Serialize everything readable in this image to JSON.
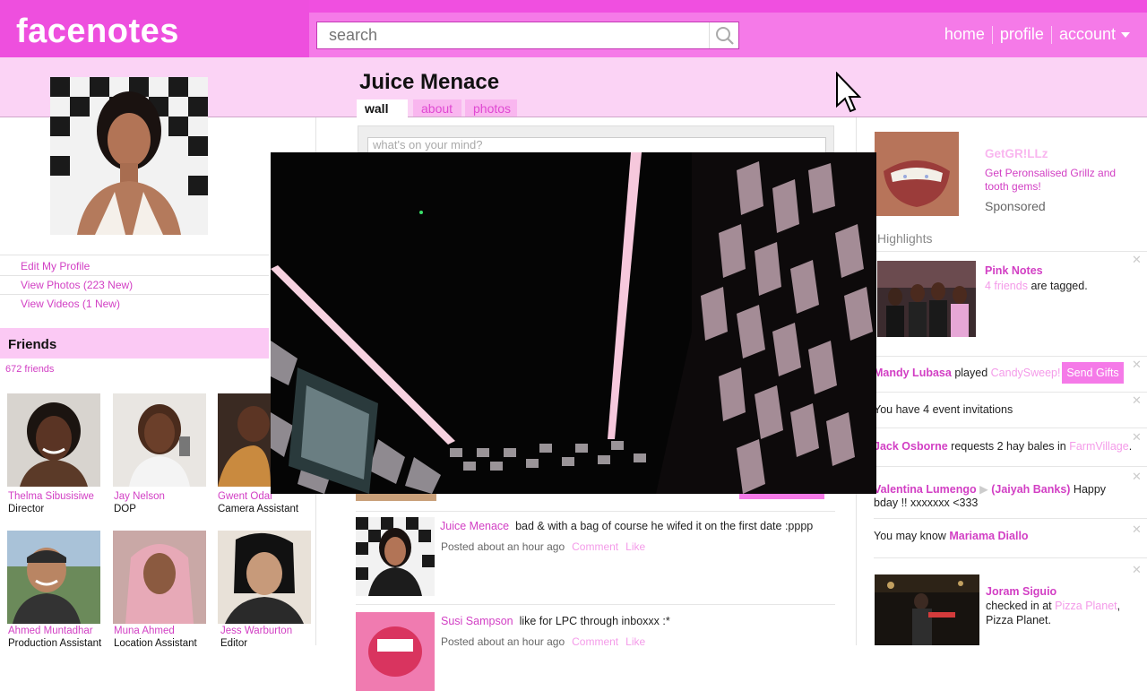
{
  "app": {
    "logo": "facenotes"
  },
  "search": {
    "placeholder": "search"
  },
  "nav": {
    "home": "home",
    "profile": "profile",
    "account": "account"
  },
  "profile": {
    "name": "Juice Menace",
    "tabs": {
      "wall": "wall",
      "about": "about",
      "photos": "photos"
    },
    "status_placeholder": "what's on your mind?"
  },
  "left": {
    "links": {
      "edit": "Edit My Profile",
      "photos": "View Photos (223 New)",
      "videos": "View Videos (1 New)"
    },
    "friends": {
      "title": "Friends",
      "count": "672 friends",
      "items": [
        {
          "name": "Thelma Sibusisiwe",
          "role": "Director"
        },
        {
          "name": "Jay Nelson",
          "role": "DOP"
        },
        {
          "name": "Gwent Odai",
          "role": "Camera Assistant"
        },
        {
          "name": "Ahmed Muntadhar",
          "role": "Production Assistant"
        },
        {
          "name": "Muna Ahmed",
          "role": "Location Assistant"
        },
        {
          "name": "Jess Warburton",
          "role": "Editor"
        }
      ]
    }
  },
  "posts": [
    {
      "author": "Juice Menace",
      "text": "bad & with a bag of course he wifed it on the first date :pppp",
      "meta": "Posted about an hour ago",
      "comment": "Comment",
      "like": "Like"
    },
    {
      "author": "Susi Sampson",
      "text": "like for LPC through inboxxx :*",
      "meta": "Posted about an hour ago",
      "comment": "Comment",
      "like": "Like"
    }
  ],
  "right": {
    "ad": {
      "title": "GetGR!LLz",
      "text": "Get Peronsalised Grillz and tooth gems!",
      "sponsored": "Sponsored"
    },
    "highlights": {
      "title": "Highlights",
      "pink_notes_title": "Pink Notes",
      "pink_notes_friends": "4 friends",
      "pink_notes_suffix": "are tagged.",
      "mandy_name": "Mandy Lubasa",
      "mandy_played": "played",
      "mandy_game": "CandySweep!",
      "send_gifts": "Send Gifts",
      "event_invites": "You have 4 event invitations",
      "jack_name": "Jack Osborne",
      "jack_text": "requests 2 hay bales in",
      "jack_game": "FarmVillage",
      "valentina_name": "Valentina Lumengo",
      "jaiyah_name": "(Jaiyah Banks)",
      "valentina_msg1": "Happy",
      "valentina_msg2": "bday !! xxxxxxx <333",
      "may_know_prefix": "You may know",
      "may_know_name": "Mariama Diallo",
      "joram_name": "Joram Siguio",
      "joram_text1": "checked in at",
      "joram_place_link": "Pizza Planet",
      "joram_text2": "Pizza Planet."
    }
  },
  "colors": {
    "brand": "#f57ae8",
    "brand_dark": "#ee4fde",
    "link": "#d23fc4",
    "light_pink": "#fbd3f5"
  }
}
